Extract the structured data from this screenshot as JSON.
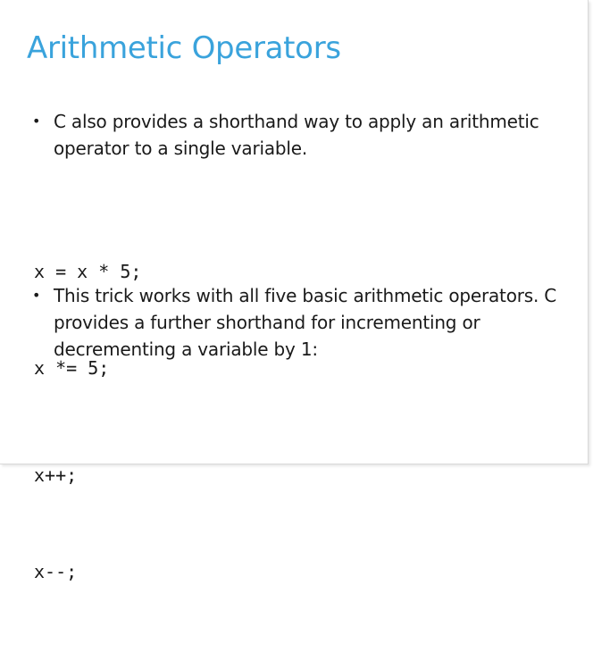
{
  "slide": {
    "title": "Arithmetic Operators",
    "bullets": [
      {
        "marker": "•",
        "text": "C also provides a shorthand way to apply an arithmetic operator to a single variable."
      },
      {
        "marker": "•",
        "text": "This trick works with all five basic arithmetic operators. C provides a further shorthand for incrementing or decrementing a variable by 1:"
      }
    ],
    "code_blocks": [
      [
        "x = x * 5;",
        "x *= 5;"
      ],
      [
        "x++;",
        "x--;"
      ]
    ],
    "colors": {
      "title": "#3aa3dc",
      "text": "#1a1a1a",
      "background": "#ffffff"
    }
  }
}
